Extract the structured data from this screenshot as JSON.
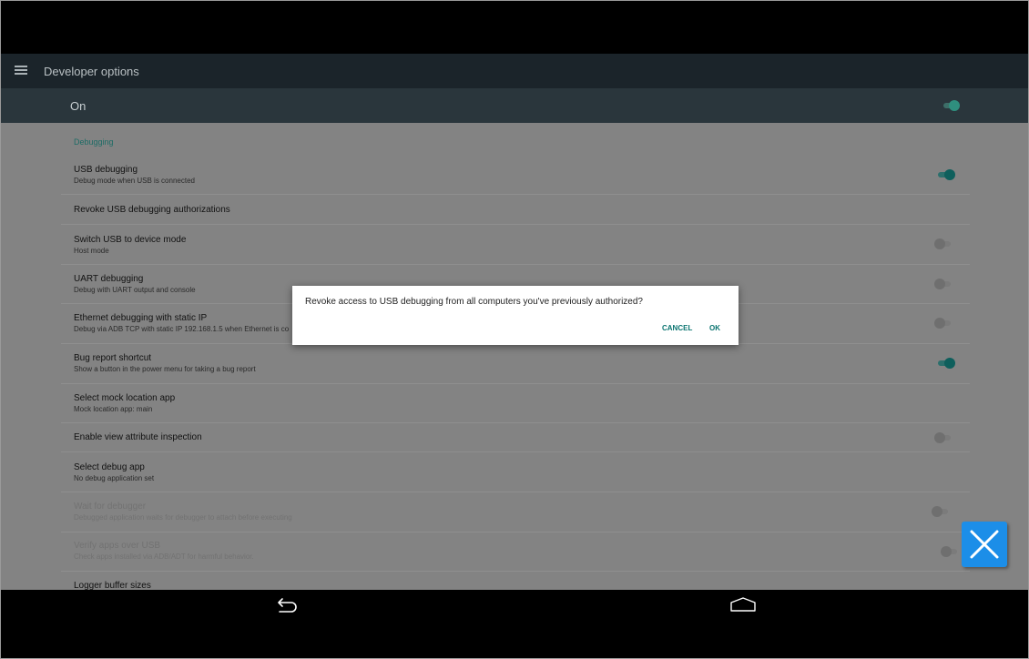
{
  "toolbar": {
    "title": "Developer options",
    "menu_icon": "hamburger-menu-icon"
  },
  "master": {
    "label": "On",
    "enabled": true
  },
  "section": {
    "header": "Debugging"
  },
  "rows": [
    {
      "title": "USB debugging",
      "subtitle": "Debug mode when USB is connected",
      "switch": "on"
    },
    {
      "title": "Revoke USB debugging authorizations",
      "subtitle": "",
      "switch": "none"
    },
    {
      "title": "Switch USB to device mode",
      "subtitle": "Host mode",
      "switch": "off"
    },
    {
      "title": "UART debugging",
      "subtitle": "Debug with UART output and console",
      "switch": "off"
    },
    {
      "title": "Ethernet debugging with static IP",
      "subtitle": "Debug via ADB TCP with static IP 192.168.1.5 when Ethernet is co",
      "switch": "off"
    },
    {
      "title": "Bug report shortcut",
      "subtitle": "Show a button in the power menu for taking a bug report",
      "switch": "on"
    },
    {
      "title": "Select mock location app",
      "subtitle": "Mock location app: main",
      "switch": "none"
    },
    {
      "title": "Enable view attribute inspection",
      "subtitle": "",
      "switch": "off"
    },
    {
      "title": "Select debug app",
      "subtitle": "No debug application set",
      "switch": "none"
    },
    {
      "title": "Wait for debugger",
      "subtitle": "Debugged application waits for debugger to attach before executing",
      "switch": "off",
      "disabled": true
    },
    {
      "title": "Verify apps over USB",
      "subtitle": "Check apps installed via ADB/ADT for harmful behavior.",
      "switch": "off",
      "disabled": true
    },
    {
      "title": "Logger buffer sizes",
      "subtitle": "",
      "switch": "none"
    }
  ],
  "dialog": {
    "message": "Revoke access to USB debugging from all computers you've previously authorized?",
    "cancel_label": "CANCEL",
    "ok_label": "OK"
  },
  "navbar": {
    "back_icon": "back-icon",
    "home_icon": "home-icon"
  },
  "overlay": {
    "close_icon": "close-icon"
  },
  "colors": {
    "accent": "#0e5f5c",
    "dialog_button": "#0a7470",
    "toolbar": "#1b242a",
    "master_bar": "#2a363c",
    "close_button": "#1c8ee8"
  }
}
